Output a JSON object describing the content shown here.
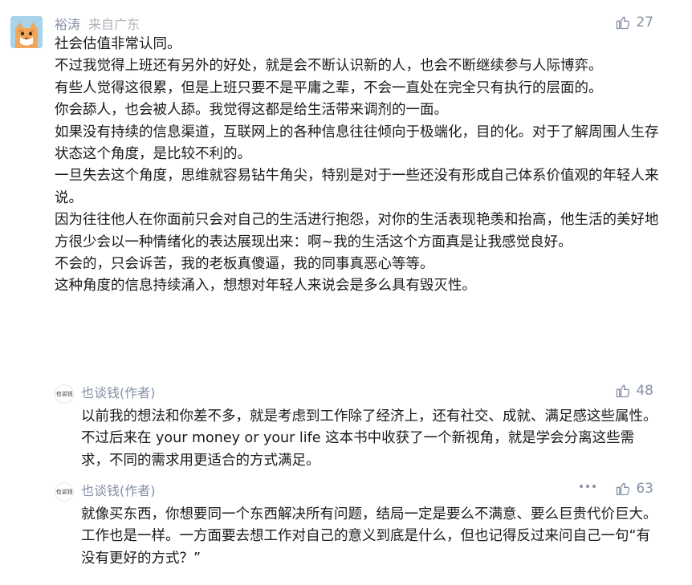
{
  "main_comment": {
    "author": "裕涛",
    "location": "来自广东",
    "likes": "27",
    "paragraphs": [
      "社会估值非常认同。",
      "不过我觉得上班还有另外的好处，就是会不断认识新的人，也会不断继续参与人际博弈。",
      "有些人觉得这很累，但是上班只要不是平庸之辈，不会一直处在完全只有执行的层面的。",
      "你会舔人，也会被人舔。我觉得这都是给生活带来调剂的一面。",
      "如果没有持续的信息渠道，互联网上的各种信息往往倾向于极端化，目的化。对于了解周围人生存状态这个角度，是比较不利的。",
      "一旦失去这个角度，思维就容易钻牛角尖，特别是对于一些还没有形成自己体系价值观的年轻人来说。",
      "因为往往他人在你面前只会对自己的生活进行抱怨，对你的生活表现艳羡和抬高，他生活的美好地方很少会以一种情绪化的表达展现出来：啊~我的生活这个方面真是让我感觉良好。",
      "不会的，只会诉苦，我的老板真傻逼，我的同事真恶心等等。",
      "这种角度的信息持续涌入，想想对年轻人来说会是多么具有毁灭性。"
    ]
  },
  "replies": [
    {
      "avatar_text": "也谈钱",
      "author": "也谈钱(作者)",
      "likes": "48",
      "text": "以前我的想法和你差不多，就是考虑到工作除了经济上，还有社交、成就、满足感这些属性。不过后来在 your money or your life 这本书中收获了一个新视角，就是学会分离这些需求，不同的需求用更适合的方式满足。"
    },
    {
      "avatar_text": "也谈钱",
      "author": "也谈钱(作者)",
      "likes": "63",
      "text": "就像买东西，你想要同一个东西解决所有问题，结局一定是要么不满意、要么巨贵代价巨大。工作也是一样。一方面要去想工作对自己的意义到底是什么，但也记得反过来问自己一句“有没有更好的方式？”"
    }
  ],
  "icons": {
    "like": "thumbs-up-icon",
    "more": "more-dots-icon",
    "avatar": "cat-avatar"
  },
  "colors": {
    "meta": "#8590a6",
    "text": "#1a1a1a"
  }
}
